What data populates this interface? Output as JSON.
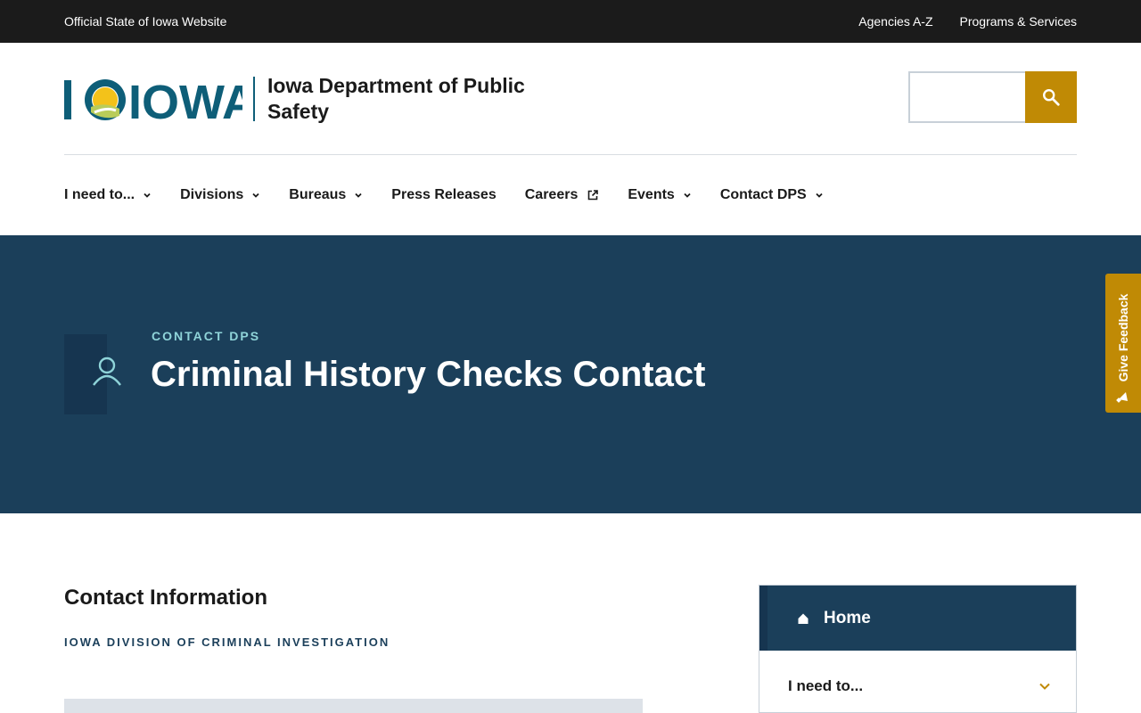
{
  "topbar": {
    "official": "Official State of Iowa Website",
    "links": [
      "Agencies A-Z",
      "Programs & Services"
    ]
  },
  "header": {
    "logo_text": "IOWA",
    "site_name": "Iowa Department of Public Safety",
    "search_placeholder": ""
  },
  "nav": [
    {
      "label": "I need to...",
      "icon": "chevron-down-icon"
    },
    {
      "label": "Divisions",
      "icon": "chevron-down-icon"
    },
    {
      "label": "Bureaus",
      "icon": "chevron-down-icon"
    },
    {
      "label": "Press Releases",
      "icon": ""
    },
    {
      "label": "Careers",
      "icon": "external-link-icon"
    },
    {
      "label": "Events",
      "icon": "chevron-down-icon"
    },
    {
      "label": "Contact DPS",
      "icon": "chevron-down-icon"
    }
  ],
  "hero": {
    "eyebrow": "CONTACT DPS",
    "title": "Criminal History Checks Contact",
    "icon": "person-icon"
  },
  "feedback": {
    "label": "Give Feedback",
    "icon": "megaphone-icon"
  },
  "main": {
    "section_title": "Contact Information",
    "section_subtitle": "IOWA DIVISION OF CRIMINAL INVESTIGATION"
  },
  "sidenav": {
    "home": "Home",
    "items": [
      "I need to..."
    ]
  },
  "colors": {
    "hero_bg": "#1b3f5a",
    "accent_gold": "#c08a05",
    "eyebrow": "#8fd4d9",
    "logo_teal": "#0e5e78"
  }
}
